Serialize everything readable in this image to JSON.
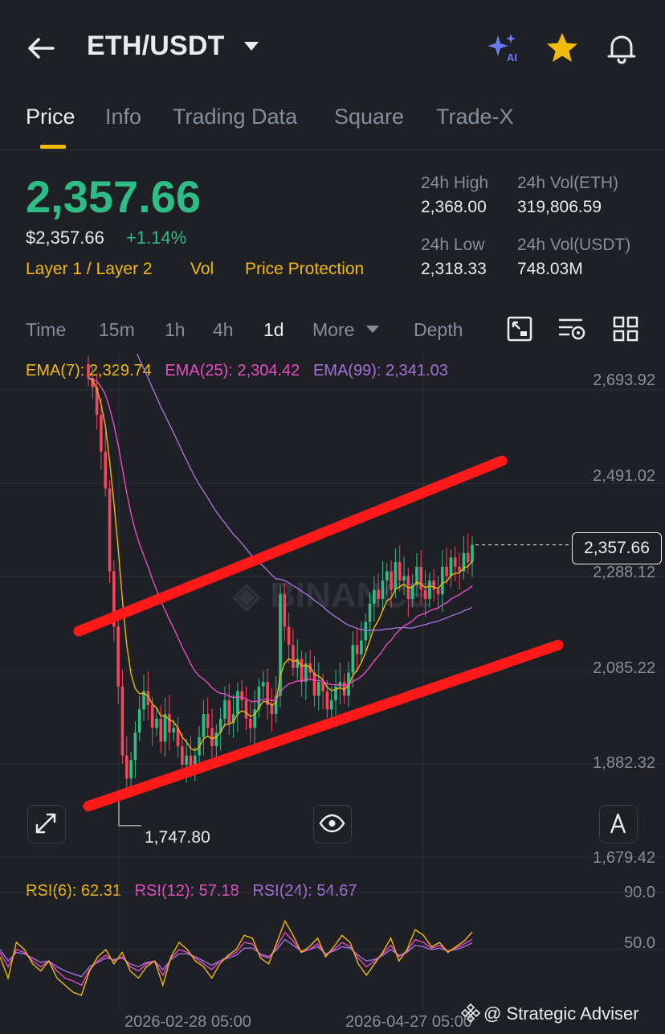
{
  "header": {
    "pair": "ETH/USDT",
    "icons": [
      "back-arrow-icon",
      "ai-sparkle-icon",
      "star-icon",
      "bell-icon"
    ]
  },
  "tabs": [
    {
      "label": "Price",
      "active": true
    },
    {
      "label": "Info"
    },
    {
      "label": "Trading Data"
    },
    {
      "label": "Square"
    },
    {
      "label": "Trade-X"
    }
  ],
  "ticker": {
    "last_price": "2,357.66",
    "usd_price": "$2,357.66",
    "change": "+1.14%",
    "tags": [
      "Layer 1 / Layer 2",
      "Vol",
      "Price Protection"
    ],
    "stats": {
      "high_label": "24h High",
      "high_value": "2,368.00",
      "vol_eth_label": "24h Vol(ETH)",
      "vol_eth_value": "319,806.59",
      "low_label": "24h Low",
      "low_value": "2,318.33",
      "vol_usdt_label": "24h Vol(USDT)",
      "vol_usdt_value": "748.03M"
    }
  },
  "timeframes": {
    "items": [
      "Time",
      "15m",
      "1h",
      "4h",
      "1d"
    ],
    "active": "1d",
    "more": "More",
    "depth": "Depth"
  },
  "indicators": {
    "ema7": "EMA(7): 2,329.74",
    "ema25": "EMA(25): 2,304.42",
    "ema99": "EMA(99): 2,341.03",
    "rsi6": "RSI(6): 62.31",
    "rsi12": "RSI(12): 57.18",
    "rsi24": "RSI(24): 54.67"
  },
  "colors": {
    "up": "#2ebd85",
    "down": "#f6465d",
    "ema7": "#f0b90b",
    "ema25": "#e64dc3",
    "ema99": "#a471d8",
    "trendline": "#ff1a1a",
    "accent": "#f0b90b"
  },
  "watermark_text": "@ Strategic Adviser",
  "chart_data": {
    "type": "candlestick",
    "y_axis_labels": [
      "2,693.92",
      "2,491.02",
      "2,288.12",
      "2,085.22",
      "1,882.32",
      "1,679.42"
    ],
    "ylim": [
      1679.42,
      2693.92
    ],
    "last_price_tag": "2,357.66",
    "low_marker": "1,747.80",
    "x_axis_labels": [
      "2026-02-28 05:00",
      "2026-04-27 05:00"
    ],
    "rsi_axis_labels": [
      "90.0",
      "50.0"
    ],
    "trendlines": [
      {
        "from": [
          0,
          2170
        ],
        "to": [
          1,
          2540
        ]
      },
      {
        "from": [
          0,
          1790
        ],
        "to": [
          1,
          2140
        ]
      }
    ],
    "closes": [
      2720,
      2700,
      2640,
      2560,
      2480,
      2300,
      2180,
      2050,
      1900,
      1850,
      1890,
      1950,
      2000,
      2040,
      2010,
      1960,
      1980,
      1930,
      1990,
      1950,
      1960,
      1920,
      1880,
      1900,
      1870,
      1900,
      1940,
      1990,
      1960,
      1920,
      1950,
      1980,
      2020,
      1970,
      1990,
      2040,
      2020,
      1980,
      1960,
      2000,
      2050,
      2060,
      2010,
      1990,
      2030,
      2250,
      2180,
      2140,
      2090,
      2110,
      2060,
      2100,
      2080,
      2030,
      2060,
      2040,
      2000,
      2020,
      2050,
      2060,
      2030,
      2080,
      2140,
      2120,
      2150,
      2190,
      2230,
      2260,
      2240,
      2280,
      2300,
      2260,
      2320,
      2280,
      2290,
      2240,
      2270,
      2310,
      2260,
      2240,
      2280,
      2260,
      2250,
      2310,
      2290,
      2330,
      2310,
      2300,
      2340,
      2320,
      2357.66
    ],
    "rsi6": [
      45,
      30,
      55,
      50,
      40,
      35,
      42,
      30,
      25,
      20,
      18,
      35,
      45,
      50,
      40,
      48,
      35,
      30,
      38,
      42,
      25,
      45,
      55,
      50,
      42,
      38,
      30,
      40,
      46,
      50,
      60,
      58,
      44,
      40,
      55,
      70,
      60,
      48,
      52,
      58,
      45,
      52,
      60,
      55,
      40,
      32,
      40,
      48,
      58,
      42,
      50,
      64,
      60,
      52,
      55,
      48,
      52,
      56,
      62.31
    ],
    "rsi12": [
      48,
      38,
      50,
      48,
      42,
      38,
      42,
      35,
      30,
      28,
      25,
      36,
      42,
      46,
      42,
      45,
      38,
      35,
      40,
      42,
      32,
      44,
      50,
      48,
      44,
      40,
      36,
      42,
      45,
      48,
      55,
      54,
      46,
      44,
      52,
      62,
      56,
      48,
      50,
      54,
      46,
      50,
      55,
      52,
      44,
      38,
      42,
      47,
      53,
      45,
      49,
      57,
      55,
      51,
      53,
      49,
      51,
      54,
      57.18
    ],
    "rsi24": [
      50,
      42,
      48,
      47,
      44,
      41,
      42,
      38,
      35,
      33,
      31,
      38,
      41,
      44,
      43,
      44,
      40,
      38,
      41,
      42,
      36,
      43,
      47,
      47,
      45,
      42,
      39,
      42,
      44,
      46,
      51,
      51,
      47,
      45,
      50,
      57,
      53,
      49,
      50,
      52,
      47,
      49,
      52,
      51,
      46,
      42,
      43,
      46,
      50,
      46,
      48,
      53,
      52,
      50,
      51,
      49,
      50,
      52,
      54.67
    ]
  }
}
